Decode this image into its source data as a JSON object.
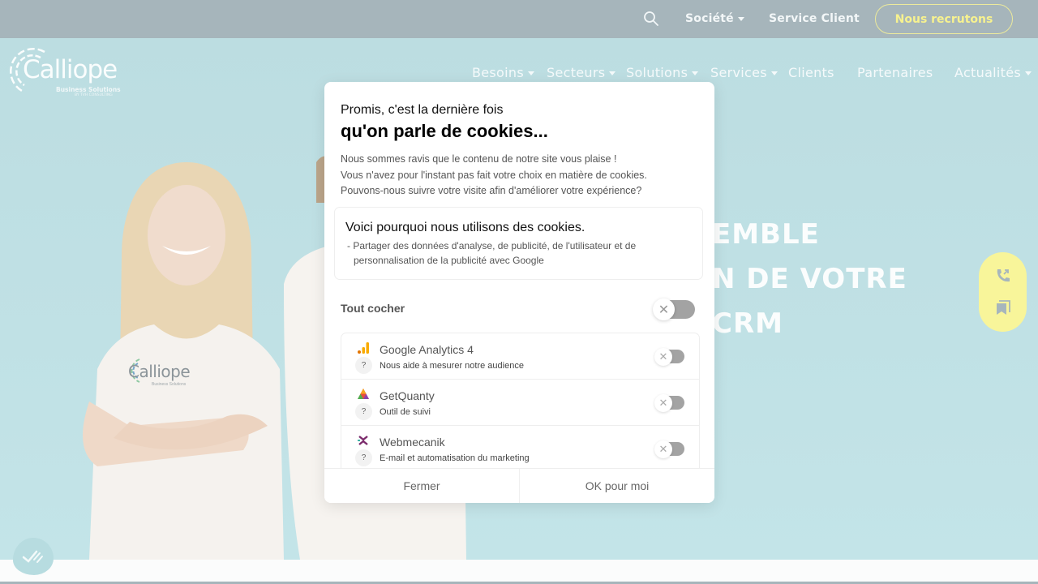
{
  "topbar": {
    "links": [
      {
        "label": "Société",
        "has_dropdown": true
      },
      {
        "label": "Service Client",
        "has_dropdown": false
      }
    ],
    "cta_label": "Nous recrutons",
    "cta_color": "#f7f28f"
  },
  "logo": {
    "name": "Calliope",
    "tagline": "Business Solutions",
    "byline": "BY TVH CONSULTING"
  },
  "nav": {
    "items": [
      {
        "label": "Besoins",
        "has_dropdown": true
      },
      {
        "label": "Secteurs",
        "has_dropdown": true
      },
      {
        "label": "Solutions",
        "has_dropdown": true
      },
      {
        "label": "Services",
        "has_dropdown": true
      },
      {
        "label": "Clients",
        "has_dropdown": false
      },
      {
        "label": "Partenaires",
        "has_dropdown": false
      },
      {
        "label": "Actualités",
        "has_dropdown": true
      }
    ]
  },
  "hero": {
    "headline_lines": [
      "EMBLE",
      "N DE VOTRE",
      "CRM"
    ],
    "shirt_logo": "Calliope",
    "shirt_tagline": "Business Solutions"
  },
  "side_widget": {
    "icons": [
      "phone-icon",
      "bookmark-icon"
    ],
    "color": "#f8f59a"
  },
  "cookie_modal": {
    "pretitle": "Promis, c'est la dernière fois",
    "title": "qu'on parle de cookies...",
    "description": [
      "Nous sommes ravis que le contenu de notre site vous plaise !",
      "Vous n'avez pour l'instant pas fait votre choix en matière de cookies.",
      "Pouvons-nous suivre votre visite afin d'améliorer votre expérience?"
    ],
    "why_title": "Voici pourquoi nous utilisons des cookies.",
    "why_body_line1": "- Partager des données d'analyse, de publicité, de l'utilisateur et de",
    "why_body_line2": "personnalisation de la publicité avec Google",
    "toggle_all_label": "Tout cocher",
    "toggle_all_state": false,
    "vendors": [
      {
        "name": "Google Analytics 4",
        "description": "Nous aide à mesurer notre audience",
        "icon": "google-analytics-icon",
        "enabled": false,
        "help": "?"
      },
      {
        "name": "GetQuanty",
        "description": "Outil de suivi",
        "icon": "getquanty-icon",
        "enabled": false,
        "help": "?"
      },
      {
        "name": "Webmecanik",
        "description": "E-mail et automatisation du marketing",
        "icon": "webmecanik-icon",
        "enabled": false,
        "help": "?"
      }
    ],
    "close_label": "Fermer",
    "accept_label": "OK pour moi"
  }
}
